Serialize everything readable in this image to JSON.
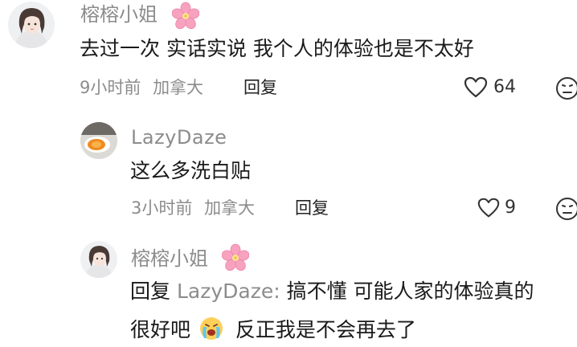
{
  "comments": [
    {
      "username": "榕榕小姐",
      "text": "去过一次 实话实说 我个人的体验也是不太好",
      "time": "9小时前",
      "location": "加拿大",
      "reply_label": "回复",
      "likes": "64"
    },
    {
      "username": "LazyDaze",
      "text": "这么多洗白贴",
      "time": "3小时前",
      "location": "加拿大",
      "reply_label": "回复",
      "likes": "9"
    },
    {
      "username": "榕榕小姐",
      "reply_prefix": "回复",
      "reply_to": "LazyDaze:",
      "text_line1": "搞不懂 可能人家的体验真的",
      "text_line2_a": "很好吧",
      "text_line2_b": "反正我是不会再去了"
    }
  ],
  "icons": {
    "name_badge": "cherry-blossom-icon",
    "like": "heart-outline-icon",
    "dislike": "neutral-face-icon",
    "emoji": "crying-face-icon"
  },
  "colors": {
    "primary_text": "#1a1a1a",
    "secondary_text": "#8c8c8c",
    "blossom": "#f58bb0"
  }
}
